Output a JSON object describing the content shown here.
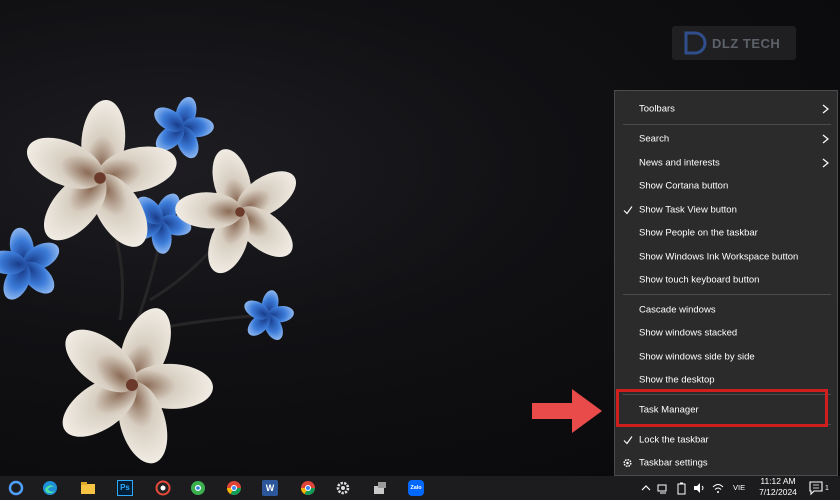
{
  "watermark": {
    "text": "DLZ TECH"
  },
  "context_menu": {
    "items": [
      {
        "label": "Toolbars",
        "submenu": true,
        "checked": false
      },
      {
        "label": "Search",
        "submenu": true,
        "checked": false
      },
      {
        "label": "News and interests",
        "submenu": true,
        "checked": false
      },
      {
        "label": "Show Cortana button",
        "submenu": false,
        "checked": false
      },
      {
        "label": "Show Task View button",
        "submenu": false,
        "checked": true
      },
      {
        "label": "Show People on the taskbar",
        "submenu": false,
        "checked": false
      },
      {
        "label": "Show Windows Ink Workspace button",
        "submenu": false,
        "checked": false
      },
      {
        "label": "Show touch keyboard button",
        "submenu": false,
        "checked": false
      },
      {
        "label": "Cascade windows",
        "submenu": false,
        "checked": false
      },
      {
        "label": "Show windows stacked",
        "submenu": false,
        "checked": false
      },
      {
        "label": "Show windows side by side",
        "submenu": false,
        "checked": false
      },
      {
        "label": "Show the desktop",
        "submenu": false,
        "checked": false
      },
      {
        "label": "Task Manager",
        "submenu": false,
        "checked": false,
        "highlighted": true
      },
      {
        "label": "Lock the taskbar",
        "submenu": false,
        "checked": true
      },
      {
        "label": "Taskbar settings",
        "submenu": false,
        "checked": false,
        "icon": "gear-icon"
      }
    ]
  },
  "annotation": {
    "highlight_color": "#d01f1f",
    "arrow_color": "#e94b4b"
  },
  "taskbar": {
    "apps": [
      "cortana-icon",
      "edge-icon",
      "file-explorer-icon",
      "photoshop-icon",
      "app-red-icon",
      "coccoc-icon",
      "chrome-icon",
      "word-icon",
      "chrome-profile-icon",
      "settings-gear-icon",
      "network-app-icon",
      "zalo-icon"
    ],
    "photoshop_label": "Ps",
    "word_label": "W",
    "zalo_label": "Zalo",
    "language": "VIE",
    "time": "11:12 AM",
    "date": "7/12/2024",
    "notification_count": "1"
  }
}
